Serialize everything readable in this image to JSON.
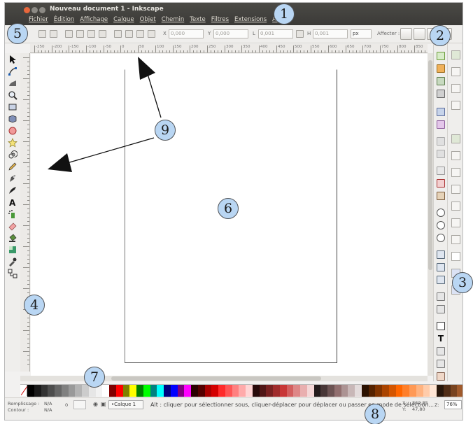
{
  "window": {
    "title": "Nouveau document 1 - Inkscape"
  },
  "menubar": {
    "items": [
      "Fichier",
      "Édition",
      "Affichage",
      "Calque",
      "Objet",
      "Chemin",
      "Texte",
      "Filtres",
      "Extensions",
      "Aide"
    ]
  },
  "commandbar": {
    "x_label": "X",
    "x_value": "0,000",
    "y_label": "Y",
    "y_value": "0,000",
    "w_label": "L",
    "w_value": "0,001",
    "h_label": "H",
    "h_value": "0,001",
    "unit": "px",
    "affect_label": "Affecter :"
  },
  "ruler": {
    "labels": [
      "-250",
      "-200",
      "-150",
      "-100",
      "-50",
      "0",
      "50",
      "100",
      "150",
      "200",
      "250",
      "300",
      "350",
      "400",
      "450",
      "500",
      "550",
      "600",
      "650",
      "700",
      "750",
      "800",
      "850"
    ]
  },
  "toolbox": {
    "tools": [
      "selector",
      "node",
      "tweak",
      "zoom",
      "rect",
      "3dbox",
      "ellipse",
      "star",
      "spiral",
      "pencil",
      "pen",
      "calligraphy",
      "text",
      "spray",
      "eraser",
      "bucket",
      "gradient",
      "dropper",
      "connector"
    ]
  },
  "statusbar": {
    "fill_label": "Remplissage :",
    "fill_value": "N/A",
    "stroke_label": "Contour :",
    "stroke_value": "N/A",
    "opacity_value": "0",
    "layer": "•Calque 1",
    "message": "Alt : cliquer pour sélectionner sous, cliquer-déplacer pour déplacer ou passer en mode de sélection...",
    "x_label": "X:",
    "x_coord": "862,85",
    "y_label": "Y:",
    "y_coord": "47,80",
    "zoom_label": "Z:",
    "zoom": "76%"
  },
  "callouts": [
    "1",
    "2",
    "3",
    "4",
    "5",
    "6",
    "7",
    "8",
    "9"
  ],
  "palette": {
    "colors": [
      "#000000",
      "#1a1a1a",
      "#333333",
      "#4d4d4d",
      "#666666",
      "#808080",
      "#999999",
      "#b3b3b3",
      "#cccccc",
      "#e6e6e6",
      "#f2f2f2",
      "#ffffff",
      "#800000",
      "#ff0000",
      "#808000",
      "#ffff00",
      "#008000",
      "#00ff00",
      "#008080",
      "#00ffff",
      "#000080",
      "#0000ff",
      "#800080",
      "#ff00ff",
      "#2b0000",
      "#550000",
      "#aa0000",
      "#d40000",
      "#ff2a2a",
      "#ff5555",
      "#ff8080",
      "#ffaaaa",
      "#ffd5d5",
      "#280b0b",
      "#501616",
      "#782121",
      "#a02c2c",
      "#c83737",
      "#d35f5f",
      "#de8787",
      "#e9afaf",
      "#f4d7d7",
      "#241c1c",
      "#483737",
      "#6c5353",
      "#916f6f",
      "#ac9393",
      "#c8b7b7",
      "#e3dbdb",
      "#2b1100",
      "#552200",
      "#803300",
      "#aa4400",
      "#d45500",
      "#ff6600",
      "#ff7f2a",
      "#ff9955",
      "#ffb380",
      "#ffccaa",
      "#ffe6d5",
      "#28170b",
      "#502d16",
      "#784421",
      "#a05a2c"
    ]
  }
}
